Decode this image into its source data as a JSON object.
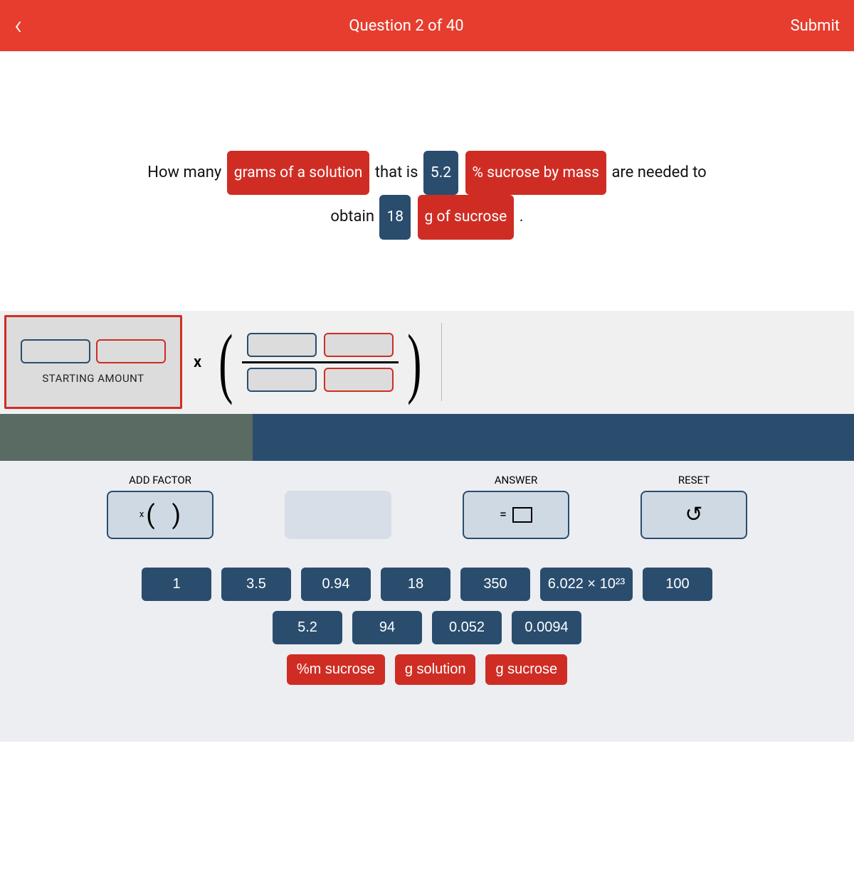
{
  "header": {
    "title": "Question 2 of 40",
    "submit": "Submit"
  },
  "question": {
    "t0": "How many",
    "chip0": "grams of a solution",
    "t1": "that is",
    "chip1": "5.2",
    "chip2": "% sucrose by mass",
    "t2": "are needed to",
    "t3": "obtain",
    "chip3": "18",
    "chip4": "g of sucrose",
    "t4": "."
  },
  "workspace": {
    "starting_label": "STARTING AMOUNT",
    "times": "x"
  },
  "controls": {
    "add_factor": "ADD FACTOR",
    "answer": "ANSWER",
    "reset": "RESET",
    "equals": "="
  },
  "values_row1": [
    "1",
    "3.5",
    "0.94",
    "18",
    "350",
    "6.022 × 10²³",
    "100"
  ],
  "values_row2": [
    "5.2",
    "94",
    "0.052",
    "0.0094"
  ],
  "units": [
    "%m sucrose",
    "g solution",
    "g sucrose"
  ]
}
